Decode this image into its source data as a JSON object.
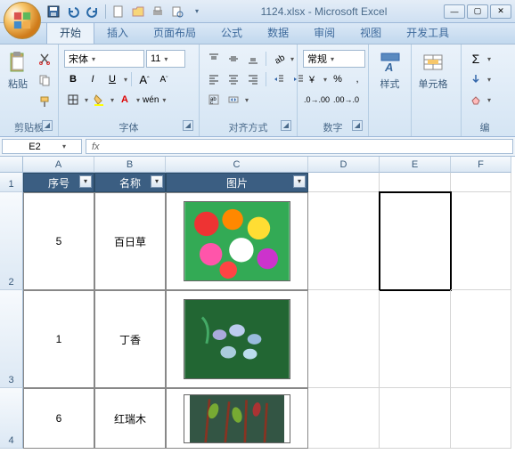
{
  "app": {
    "title": "1124.xlsx - Microsoft Excel"
  },
  "qat": {
    "items": [
      "save-icon",
      "undo-icon",
      "redo-icon",
      "new-icon",
      "open-icon",
      "quickprint-icon",
      "preview-icon"
    ]
  },
  "tabs": {
    "items": [
      "开始",
      "插入",
      "页面布局",
      "公式",
      "数据",
      "审阅",
      "视图",
      "开发工具"
    ],
    "active": 0
  },
  "ribbon": {
    "clipboard": {
      "label": "剪贴板",
      "paste": "粘贴"
    },
    "font": {
      "label": "字体",
      "name": "宋体",
      "size": "11",
      "b": "B",
      "i": "I",
      "u": "U"
    },
    "alignment": {
      "label": "对齐方式"
    },
    "number": {
      "label": "数字",
      "format": "常规"
    },
    "styles": {
      "label": "样式"
    },
    "cells": {
      "label": "单元格"
    },
    "editing": {
      "label": "编"
    }
  },
  "formula_bar": {
    "name_box": "E2",
    "fx": "fx",
    "value": ""
  },
  "sheet": {
    "col_widths": {
      "A": 80,
      "B": 80,
      "C": 160,
      "D": 80,
      "E": 80,
      "F": 68
    },
    "columns": [
      "A",
      "B",
      "C",
      "D",
      "E",
      "F"
    ],
    "row_heights": {
      "1": 22,
      "2": 110,
      "3": 110,
      "4": 68
    },
    "rows": [
      "1",
      "2",
      "3",
      "4"
    ],
    "headers": {
      "A": "序号",
      "B": "名称",
      "C": "图片"
    },
    "data": [
      {
        "seq": "5",
        "name": "百日草"
      },
      {
        "seq": "1",
        "name": "丁香"
      },
      {
        "seq": "6",
        "name": "红瑞木"
      }
    ]
  }
}
